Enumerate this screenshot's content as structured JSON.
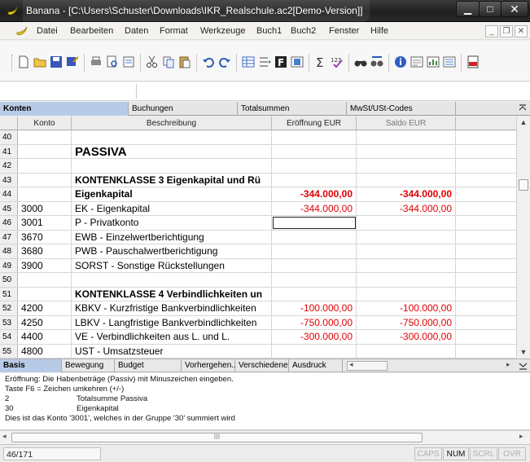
{
  "window": {
    "title": "Banana - [C:\\Users\\Schuster\\Downloads\\IKR_Realschule.ac2[Demo-Version]]",
    "controls": {
      "minimize": "▁",
      "maximize": "□",
      "close": "✕"
    }
  },
  "menubar": {
    "items": [
      "Datei",
      "Bearbeiten",
      "Daten",
      "Format",
      "Werkzeuge",
      "Buch1",
      "Buch2",
      "Fenster",
      "Hilfe"
    ],
    "mdi": {
      "minimize": "_",
      "restore": "❐",
      "close": "✕"
    }
  },
  "table_tabs": {
    "active": "Konten",
    "items": [
      "Konten",
      "Buchungen",
      "Totalsummen",
      "MwSt/USt-Codes"
    ]
  },
  "grid": {
    "columns": [
      "Konto",
      "Beschreibung",
      "Eröffnung EUR",
      "Saldo EUR"
    ],
    "rows": [
      {
        "row": "40",
        "konto": "",
        "beschreibung": "",
        "eroeffnung": "",
        "saldo": "",
        "style": "plain"
      },
      {
        "row": "41",
        "konto": "",
        "beschreibung": "PASSIVA",
        "eroeffnung": "",
        "saldo": "",
        "style": "header"
      },
      {
        "row": "42",
        "konto": "",
        "beschreibung": "",
        "eroeffnung": "",
        "saldo": "",
        "style": "plain"
      },
      {
        "row": "43",
        "konto": "",
        "beschreibung": "KONTENKLASSE 3  Eigenkapital und Rü",
        "eroeffnung": "",
        "saldo": "",
        "style": "bold"
      },
      {
        "row": "44",
        "konto": "",
        "beschreibung": "Eigenkapital",
        "eroeffnung": "-344.000,00",
        "saldo": "-344.000,00",
        "style": "bold"
      },
      {
        "row": "45",
        "konto": "3000",
        "beschreibung": "EK - Eigenkapital",
        "eroeffnung": "-344.000,00",
        "saldo": "-344.000,00",
        "style": "plain"
      },
      {
        "row": "46",
        "konto": "3001",
        "beschreibung": "P - Privatkonto",
        "eroeffnung": "",
        "saldo": "",
        "style": "plain",
        "selected": true
      },
      {
        "row": "47",
        "konto": "3670",
        "beschreibung": "EWB - Einzelwertberichtigung",
        "eroeffnung": "",
        "saldo": "",
        "style": "plain"
      },
      {
        "row": "48",
        "konto": "3680",
        "beschreibung": "PWB - Pauschalwertberichtigung",
        "eroeffnung": "",
        "saldo": "",
        "style": "plain"
      },
      {
        "row": "49",
        "konto": "3900",
        "beschreibung": "SORST - Sonstige Rückstellungen",
        "eroeffnung": "",
        "saldo": "",
        "style": "plain"
      },
      {
        "row": "50",
        "konto": "",
        "beschreibung": "",
        "eroeffnung": "",
        "saldo": "",
        "style": "plain"
      },
      {
        "row": "51",
        "konto": "",
        "beschreibung": "KONTENKLASSE 4 Verbindlichkeiten un",
        "eroeffnung": "",
        "saldo": "",
        "style": "bold"
      },
      {
        "row": "52",
        "konto": "4200",
        "beschreibung": "KBKV - Kurzfristige Bankverbindlichkeiten",
        "eroeffnung": "-100.000,00",
        "saldo": "-100.000,00",
        "style": "plain"
      },
      {
        "row": "53",
        "konto": "4250",
        "beschreibung": "LBKV - Langfristige Bankverbindlichkeiten",
        "eroeffnung": "-750.000,00",
        "saldo": "-750.000,00",
        "style": "plain"
      },
      {
        "row": "54",
        "konto": "4400",
        "beschreibung": "VE - Verbindlichkeiten aus L. und L.",
        "eroeffnung": "-300.000,00",
        "saldo": "-300.000,00",
        "style": "plain"
      },
      {
        "row": "55",
        "konto": "4800",
        "beschreibung": "UST - Umsatzsteuer",
        "eroeffnung": "",
        "saldo": "",
        "style": "plain"
      }
    ]
  },
  "view_tabs": {
    "active": "Basis",
    "items": [
      "Basis",
      "Bewegung",
      "Budget",
      "Vorhergehen..",
      "Verschiedene",
      "Ausdruck"
    ]
  },
  "info": {
    "line1": "Eröffnung: Die Habenbeträge (Passiv) mit Minuszeichen eingeben.",
    "line2": "Taste F6 = Zeichen umkehren (+/-)",
    "group_code": "2",
    "group_name": "Totalsumme Passiva",
    "subgroup_code": "30",
    "subgroup_name": "Eigenkapital",
    "line5": "Dies ist das Konto '3001', welches in der Gruppe '30' summiert wird"
  },
  "hscroll": {
    "grip": "III"
  },
  "status": {
    "count": "46/171",
    "keys": [
      {
        "label": "CAPS",
        "on": false
      },
      {
        "label": "NUM",
        "on": true
      },
      {
        "label": "SCRL",
        "on": false
      },
      {
        "label": "OVR",
        "on": false
      }
    ]
  },
  "colors": {
    "negative": "#e00000",
    "active_tab": "#b8cbe6",
    "titlebar": "#2a2a2a"
  }
}
